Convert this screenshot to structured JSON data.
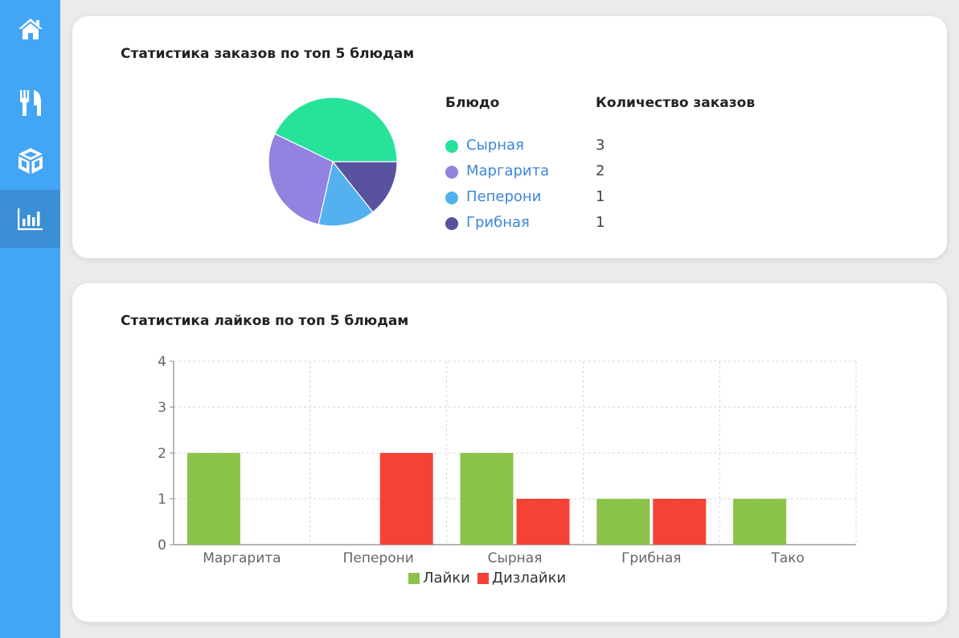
{
  "sidebar": {
    "items": [
      {
        "name": "home",
        "icon": "home-icon"
      },
      {
        "name": "menu",
        "icon": "fork-knife-icon"
      },
      {
        "name": "products",
        "icon": "box-icon"
      },
      {
        "name": "statistics",
        "icon": "bar-chart-icon",
        "active": true
      }
    ],
    "color": "#42a5f5",
    "active_color": "#3b8fd6"
  },
  "orders_card": {
    "title": "Статистика заказов по топ 5 блюдам",
    "col_dish": "Блюдо",
    "col_count": "Количество заказов",
    "rows": [
      {
        "dish": "Сырная",
        "count": "3",
        "color": "#26e29a"
      },
      {
        "dish": "Маргарита",
        "count": "2",
        "color": "#9382e0"
      },
      {
        "dish": "Пеперони",
        "count": "1",
        "color": "#54b1ef"
      },
      {
        "dish": "Грибная",
        "count": "1",
        "color": "#59529e"
      }
    ]
  },
  "likes_card": {
    "title": "Статистика лайков по топ 5 блюдам"
  },
  "chart_data": [
    {
      "type": "pie",
      "categories": [
        "Сырная",
        "Маргарита",
        "Пеперони",
        "Грибная"
      ],
      "values": [
        3,
        2,
        1,
        1
      ],
      "colors": [
        "#26e29a",
        "#9382e0",
        "#54b1ef",
        "#59529e"
      ]
    },
    {
      "type": "bar",
      "categories": [
        "Маргарита",
        "Пеперони",
        "Сырная",
        "Грибная",
        "Тако"
      ],
      "series": [
        {
          "name": "Лайки",
          "values": [
            2,
            0,
            2,
            1,
            1
          ],
          "color": "#8bc34a"
        },
        {
          "name": "Дизлайки",
          "values": [
            0,
            2,
            1,
            1,
            0
          ],
          "color": "#f44336"
        }
      ],
      "ylim": [
        0,
        4
      ],
      "yticks": [
        "0",
        "1",
        "2",
        "3",
        "4"
      ],
      "grid": true,
      "legend": "bottom"
    }
  ]
}
